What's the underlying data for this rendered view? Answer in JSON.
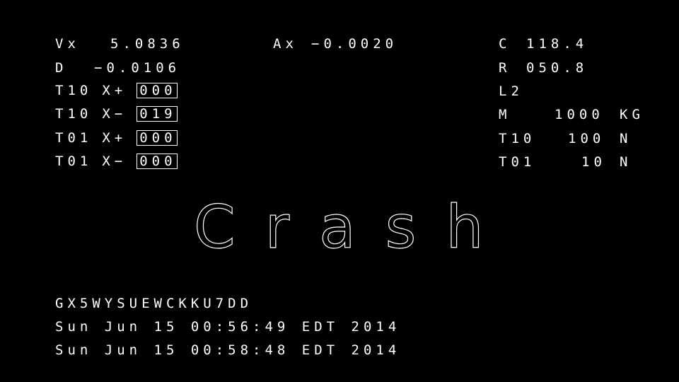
{
  "left_panel": {
    "vx_label": "Vx",
    "vx_value": "5.0836",
    "d_label": "D",
    "d_value": "−0.0106",
    "thrusters": [
      {
        "name": "T10",
        "dir": "X+",
        "value": "000"
      },
      {
        "name": "T10",
        "dir": "X−",
        "value": "019"
      },
      {
        "name": "T01",
        "dir": "X+",
        "value": "000"
      },
      {
        "name": "T01",
        "dir": "X−",
        "value": "000"
      }
    ]
  },
  "center_panel": {
    "ax_label": "Ax",
    "ax_value": "−0.0020"
  },
  "right_panel": {
    "c_label": "C",
    "c_value": "118.4",
    "r_label": "R",
    "r_value": "050.8",
    "level": "L2",
    "mass_label": "M",
    "mass_value": "1000",
    "mass_unit": "KG",
    "t10_label": "T10",
    "t10_value": "100",
    "t10_unit": "N",
    "t01_label": "T01",
    "t01_value": "10",
    "t01_unit": "N"
  },
  "message": "Crash!",
  "footer": {
    "code": "GX5WYSUEWCKKU7DD",
    "start_time": "Sun Jun 15 00:56:49 EDT 2014",
    "end_time": "Sun Jun 15 00:58:48 EDT 2014"
  },
  "colors": {
    "background": "#000000",
    "foreground": "#ffffff"
  }
}
